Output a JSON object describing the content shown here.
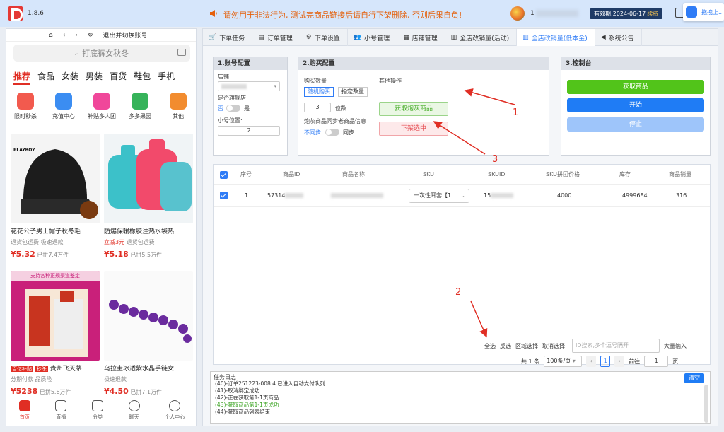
{
  "app": {
    "version": "1.8.6"
  },
  "header": {
    "warning": "请勿用于非法行为, 测试完商品链接后请自行下架删除, 否则后果自负!",
    "user_id": "1",
    "expiry_label": "有效期:2024-06-17",
    "renew": "续费",
    "extension_text": "拖拽上..."
  },
  "phone": {
    "nav_label": "退出并切换账号",
    "search_placeholder": "打底裤女秋冬",
    "categories": [
      "推荐",
      "食品",
      "女装",
      "男装",
      "百货",
      "鞋包",
      "手机"
    ],
    "quick": [
      {
        "label": "限时秒杀",
        "color": "#f25a4e"
      },
      {
        "label": "充值中心",
        "color": "#3b8df2"
      },
      {
        "label": "补贴多人团",
        "color": "#f0479a"
      },
      {
        "label": "多多果园",
        "color": "#36b35a"
      },
      {
        "label": "其他",
        "color": "#f28c2f"
      }
    ],
    "products": [
      {
        "title": "花花公子男士帽子秋冬毛",
        "tags": "退货包运费 极速退款",
        "price": "¥5.32",
        "sold": "已拼7.4万件",
        "color": "#222",
        "brand": "PLAYBOY"
      },
      {
        "title": "防爆保暖橡胶注热水袋热",
        "tags_red": "立减3元",
        "tags": "退货包运费",
        "price": "¥5.18",
        "sold": "已拼5.5万件",
        "color": "#3cc1c9"
      },
      {
        "title": "贵州飞天茅",
        "tags": "分期付款 品质险",
        "price": "¥5238",
        "sold": "已拼5.6万件",
        "color": "#c9207a",
        "banner": "支持各种正规渠道鉴定",
        "badge1": "百亿补贴",
        "badge2": "秒杀"
      },
      {
        "title": "乌拉圭冰透紫水晶手链女",
        "tags": "极速退款",
        "price": "¥4.50",
        "sold": "已拼7.1万件",
        "color": "#6a2b9e"
      }
    ],
    "tabbar": [
      "首页",
      "直播",
      "分类",
      "聊天",
      "个人中心"
    ]
  },
  "tabs": [
    {
      "label": "下单任务",
      "icon": "cart-icon"
    },
    {
      "label": "订单管理",
      "icon": "doc-icon"
    },
    {
      "label": "下单设置",
      "icon": "gear-icon"
    },
    {
      "label": "小号管理",
      "icon": "users-icon"
    },
    {
      "label": "店铺管理",
      "icon": "shop-icon"
    },
    {
      "label": "全店改销量(活动)",
      "icon": "chart-icon"
    },
    {
      "label": "全店改销量(低本金)",
      "icon": "chart-icon"
    },
    {
      "label": "系统公告",
      "icon": "speaker-icon"
    }
  ],
  "account_config": {
    "title": "1.账号配置",
    "shop_label": "店铺:",
    "flagship_label": "是否旗舰店",
    "no": "否",
    "yes": "是",
    "position_label": "小号位置:",
    "position_value": "2"
  },
  "purchase_config": {
    "title": "2.购买配置",
    "qty_label": "购买数量",
    "random": "随机购买",
    "fixed": "指定数量",
    "digits_value": "3",
    "digits_label": "位数",
    "sync_label": "炮灰商品同步老商品信息",
    "not_sync": "不同步",
    "sync": "同步",
    "other_ops": "其他操作",
    "fetch_gray": "获取炮灰商品",
    "unlist": "下架选中"
  },
  "control": {
    "title": "3.控制台",
    "fetch": "获取商品",
    "start": "开始",
    "stop": "停止"
  },
  "table": {
    "headers": [
      "序号",
      "商品ID",
      "商品名称",
      "SKU",
      "SKUID",
      "SKU拼团价格",
      "库存",
      "商品销量"
    ],
    "row": {
      "index": "1",
      "id": "57314",
      "sku": "一次性耳套【1",
      "skuid": "15",
      "price": "4000",
      "stock": "4999684",
      "sales": "316"
    }
  },
  "bulk": {
    "select_all": "全选",
    "invert": "反选",
    "range": "区域选择",
    "cancel": "取消选择",
    "id_placeholder": "ID搜索,多个逗号隔开",
    "bulk_input": "大量输入"
  },
  "pager": {
    "total": "共 1 条",
    "page_size": "100条/页",
    "current": "1",
    "goto": "前往",
    "goto_value": "1",
    "page": "页"
  },
  "log": {
    "title": "任务日志",
    "clear": "清空",
    "lines": [
      {
        "text": "(40)-订单251223-008 4.已进入自动支付队列",
        "ok": false
      },
      {
        "text": "(41)-取消绑定成功",
        "ok": false
      },
      {
        "text": "(42)-正在获取第1-1页商品",
        "ok": false
      },
      {
        "text": "(43)-获取商品第1-1页成功",
        "ok": true
      },
      {
        "text": "(44)-获取商品列表结束",
        "ok": false
      }
    ]
  },
  "annotations": [
    "1",
    "2",
    "3"
  ]
}
